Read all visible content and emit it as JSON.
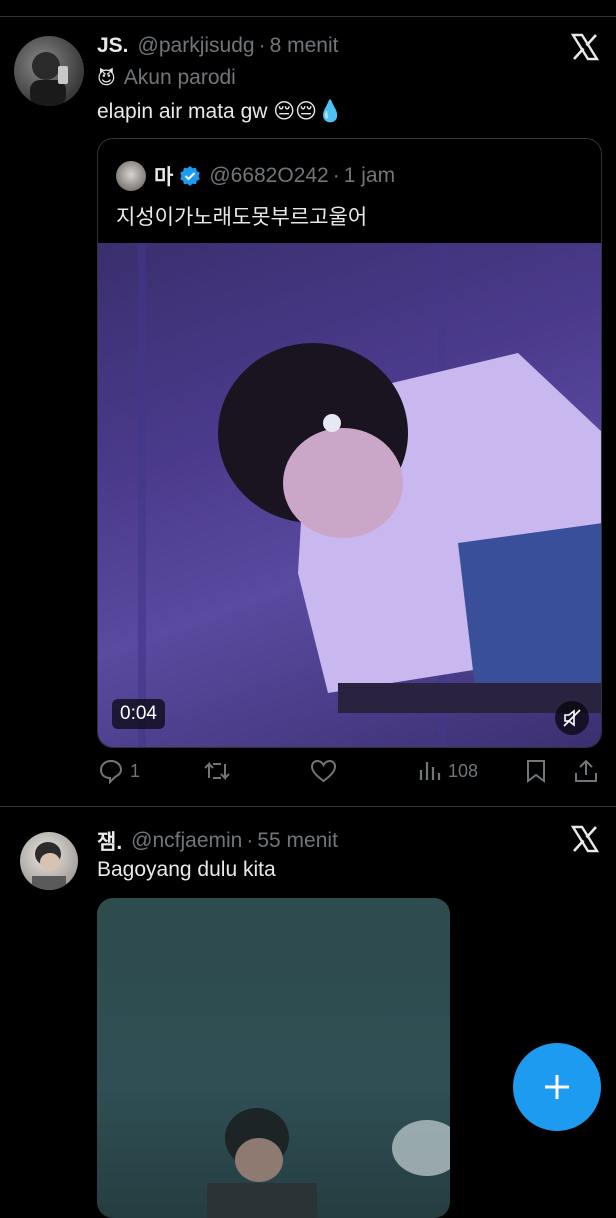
{
  "tweet1": {
    "name": "JS.",
    "handle": "@parkjisudg",
    "sep": "·",
    "time": "8 menit",
    "label_emoji": "😈",
    "label": "Akun parodi",
    "text": "elapin air mata gw 😔😔💧",
    "quote": {
      "name": "마",
      "handle": "@6682O242",
      "sep": "·",
      "time": "1 jam",
      "text": "지성이가노래도못부르고울어",
      "video_duration": "0:04"
    },
    "actions": {
      "replies": "1",
      "views": "108"
    }
  },
  "tweet2": {
    "name": "잼.",
    "handle": "@ncfjaemin",
    "sep": "·",
    "time": "55 menit",
    "text": "Bagoyang dulu kita"
  },
  "colors": {
    "background": "#000000",
    "accent": "#1d9bf0",
    "muted": "#71767b",
    "verified": "#1d9bf0"
  }
}
